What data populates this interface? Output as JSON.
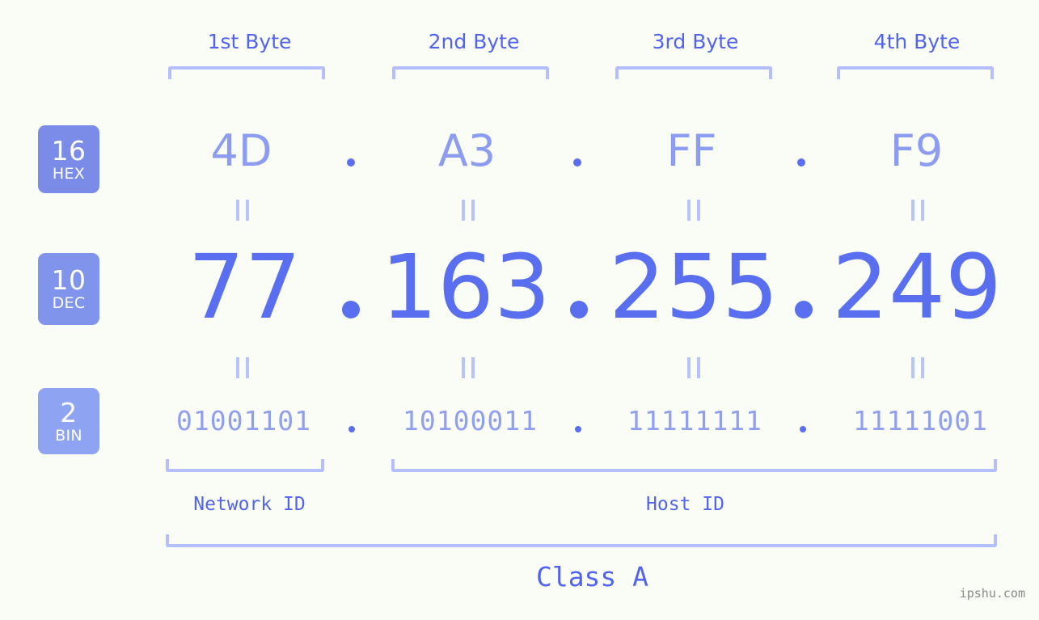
{
  "ip_address": {
    "dotted_decimal": "77.163.255.249",
    "class": "Class A"
  },
  "notation_badges": [
    {
      "base": "16",
      "name": "HEX",
      "color": "#7a8ce8"
    },
    {
      "base": "10",
      "name": "DEC",
      "color": "#8094ec"
    },
    {
      "base": "2",
      "name": "BIN",
      "color": "#8ea3f2"
    }
  ],
  "byte_headers": [
    {
      "label": "1st Byte"
    },
    {
      "label": "2nd Byte"
    },
    {
      "label": "3rd Byte"
    },
    {
      "label": "4th Byte"
    }
  ],
  "rows": {
    "hex": {
      "values": [
        "4D",
        "A3",
        "FF",
        "F9"
      ]
    },
    "dec": {
      "values": [
        "77",
        "163",
        "255",
        "249"
      ]
    },
    "bin": {
      "values": [
        "01001101",
        "10100011",
        "11111111",
        "11111001"
      ]
    }
  },
  "separators": {
    "dot": ".",
    "equals": "="
  },
  "sections": {
    "network_id": "Network ID",
    "host_id": "Host ID",
    "class_label": "Class A"
  },
  "watermark": "ipshu.com",
  "colors": {
    "background": "#fafdf6",
    "header_text": "#5263ef",
    "bracket": "#b4bffb",
    "hex_text": "#8c9cf0",
    "dec_text": "#5a6ff0",
    "bin_text": "#909fef",
    "badge_text": "#ffffff",
    "watermark_text": "#8a8a8a"
  }
}
